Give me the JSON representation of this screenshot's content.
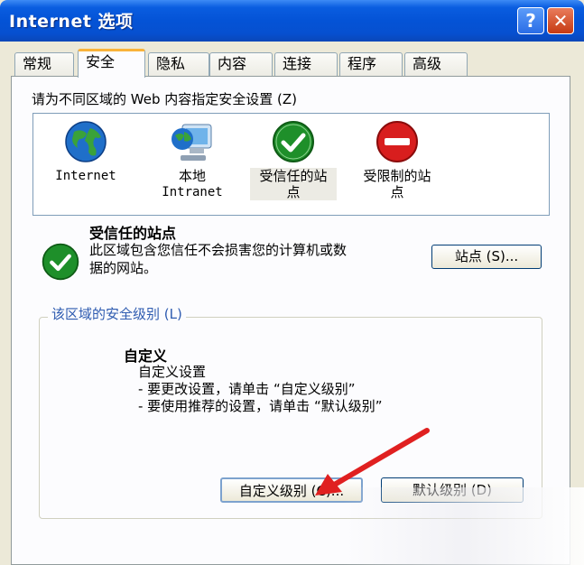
{
  "window": {
    "title": "Internet 选项",
    "help_label": "?",
    "close_label": "✕"
  },
  "tabs": [
    {
      "label": "常规"
    },
    {
      "label": "安全"
    },
    {
      "label": "隐私"
    },
    {
      "label": "内容"
    },
    {
      "label": "连接"
    },
    {
      "label": "程序"
    },
    {
      "label": "高级"
    }
  ],
  "active_tab": "安全",
  "prompt": "请为不同区域的 Web 内容指定安全设置 (Z)",
  "zones": [
    {
      "line1": "Internet",
      "line2": "",
      "icon": "globe-icon"
    },
    {
      "line1": "本地",
      "line2": "Intranet",
      "icon": "intranet-icon"
    },
    {
      "line1": "受信任的站",
      "line2": "点",
      "icon": "trusted-checkmark-icon"
    },
    {
      "line1": "受限制的站",
      "line2": "点",
      "icon": "restricted-icon"
    }
  ],
  "selected_zone": {
    "title": "受信任的站点",
    "description": "此区域包含您信任不会损害您的计算机或数据的网站。",
    "sites_button": "站点 (S)..."
  },
  "security_level": {
    "legend": "该区域的安全级别 (L)",
    "title": "自定义",
    "lines": [
      "自定义设置",
      "- 要更改设置，请单击 “自定义级别”",
      "- 要使用推荐的设置，请单击 “默认级别”"
    ],
    "custom_button": "自定义级别 (C)...",
    "default_button": "默认级别 (D)"
  },
  "colors": {
    "titlebar": "#0453d6",
    "dialog_bg": "#ece9d8",
    "tab_highlight": "#f9b33a",
    "arrow": "#e02020"
  }
}
